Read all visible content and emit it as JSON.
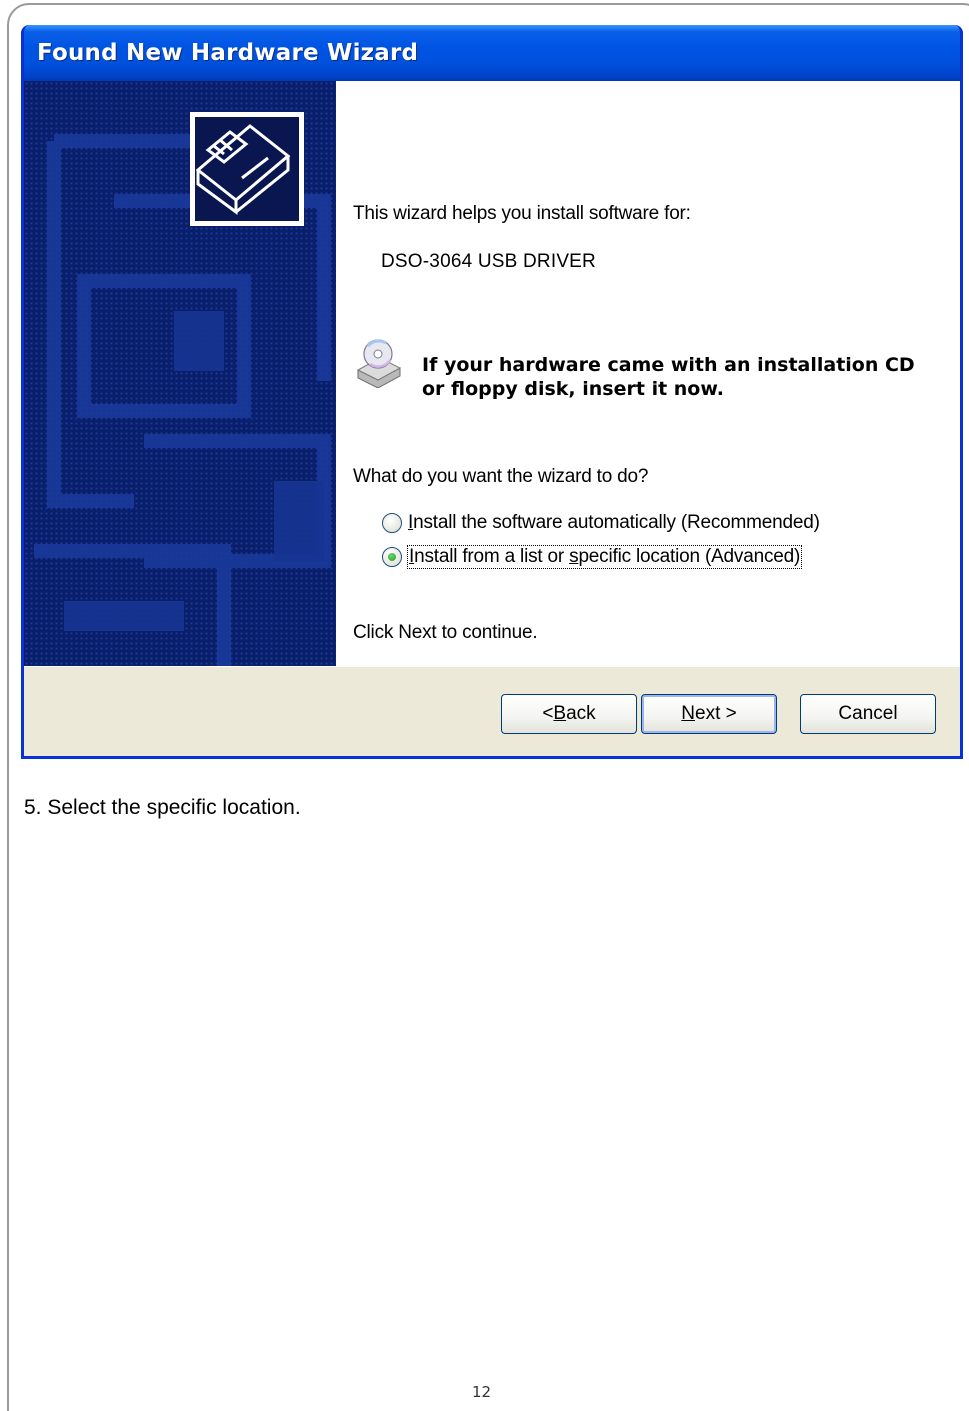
{
  "wizard": {
    "title": "Found New Hardware Wizard",
    "intro": "This wizard helps you install software for:",
    "device_name": "DSO-3064 USB DRIVER",
    "cd_prompt_line1": "If your hardware came with an installation CD",
    "cd_prompt_line2": "or floppy disk, insert it now.",
    "question": "What do you want the wizard to do?",
    "options": [
      {
        "prefix": "",
        "accel": "I",
        "suffix": "nstall the software automatically (Recommended)",
        "selected": false
      },
      {
        "prefix": "",
        "accel": "I",
        "middle": "nstall from a list or ",
        "accel2": "s",
        "suffix": "pecific location (Advanced)",
        "selected": true
      }
    ],
    "continue_hint": "Click Next to continue.",
    "buttons": {
      "back_pre": "< ",
      "back_accel": "B",
      "back_post": "ack",
      "next_accel": "N",
      "next_post": "ext >",
      "cancel": "Cancel"
    },
    "colors": {
      "titlebar": "#0054e3",
      "side_panel": "#0a1f6b",
      "button_bar": "#ece9d8",
      "radio_selected": "#21a121"
    },
    "icons": {
      "hardware": "hardware-card-icon",
      "cd": "cd-drive-icon"
    }
  },
  "caption": "5. Select the specific location.",
  "page_number": "12"
}
